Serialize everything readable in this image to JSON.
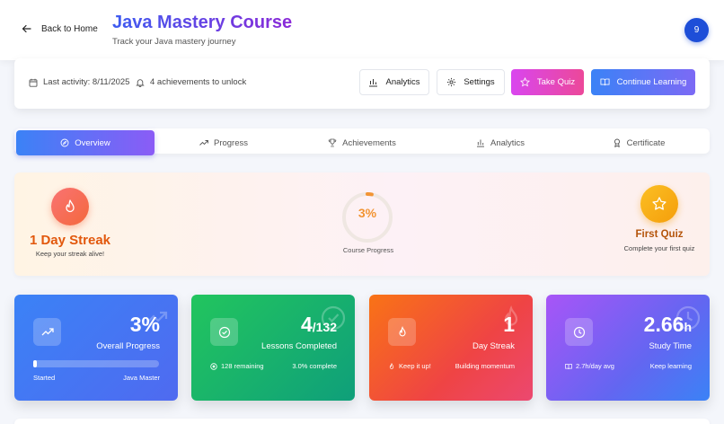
{
  "header": {
    "back_label": "Back to Home",
    "title": "Java Mastery Course",
    "subtitle": "Track your Java mastery journey",
    "avatar_text": "9"
  },
  "toolbar": {
    "last_activity": "Last activity: 8/11/2025",
    "achievements": "4 achievements to unlock",
    "buttons": {
      "analytics": "Analytics",
      "settings": "Settings",
      "take_quiz": "Take Quiz",
      "continue": "Continue Learning"
    }
  },
  "tabs": [
    {
      "label": "Overview",
      "icon": "compass-icon",
      "active": true
    },
    {
      "label": "Progress",
      "icon": "trending-up-icon"
    },
    {
      "label": "Achievements",
      "icon": "trophy-icon"
    },
    {
      "label": "Analytics",
      "icon": "bar-chart-icon"
    },
    {
      "label": "Certificate",
      "icon": "award-icon"
    }
  ],
  "streak_panel": {
    "streak_title": "1 Day Streak",
    "streak_sub": "Keep your streak alive!",
    "progress_value": "3%",
    "progress_fraction": 0.03,
    "progress_label": "Course Progress",
    "quiz_title": "First Quiz",
    "quiz_sub": "Complete your first quiz"
  },
  "cards": {
    "progress": {
      "value": "3%",
      "label": "Overall Progress",
      "bar_fraction": 0.03,
      "start_label": "Started",
      "end_label": "Java Master"
    },
    "lessons": {
      "value": "4",
      "total": "/132",
      "label": "Lessons Completed",
      "remaining": "128 remaining",
      "complete": "3.0% complete"
    },
    "streak": {
      "value": "1",
      "label": "Day Streak",
      "foot_left": "Keep it up!",
      "foot_right": "Building momentum"
    },
    "study": {
      "value": "2.66",
      "unit": "h",
      "label": "Study Time",
      "foot_left": "2.7h/day avg",
      "foot_right": "Keep learning"
    }
  },
  "colors": {
    "accent_blue": "#3b82f6",
    "accent_purple": "#8b5cf6",
    "streak_orange": "#e2580d",
    "quiz_gold": "#f59e0b"
  }
}
